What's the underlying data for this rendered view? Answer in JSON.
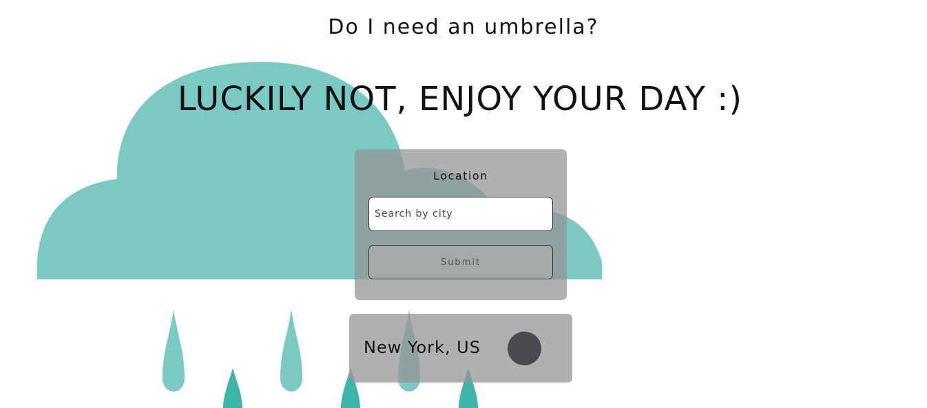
{
  "header": {
    "question": "Do I need an umbrella?",
    "answer": "LUCKILY NOT, ENJOY YOUR DAY :)"
  },
  "form": {
    "label": "Location",
    "search_placeholder": "Search by city",
    "search_value": "",
    "submit_label": "Submit"
  },
  "result": {
    "city": "New York, US",
    "icon": "weather-icon"
  },
  "colors": {
    "cloud": "#7ac9c3",
    "raindrop_dark": "#3db5a8",
    "card_bg": "#b0b0b0",
    "weather_icon": "#4a4a4e"
  }
}
